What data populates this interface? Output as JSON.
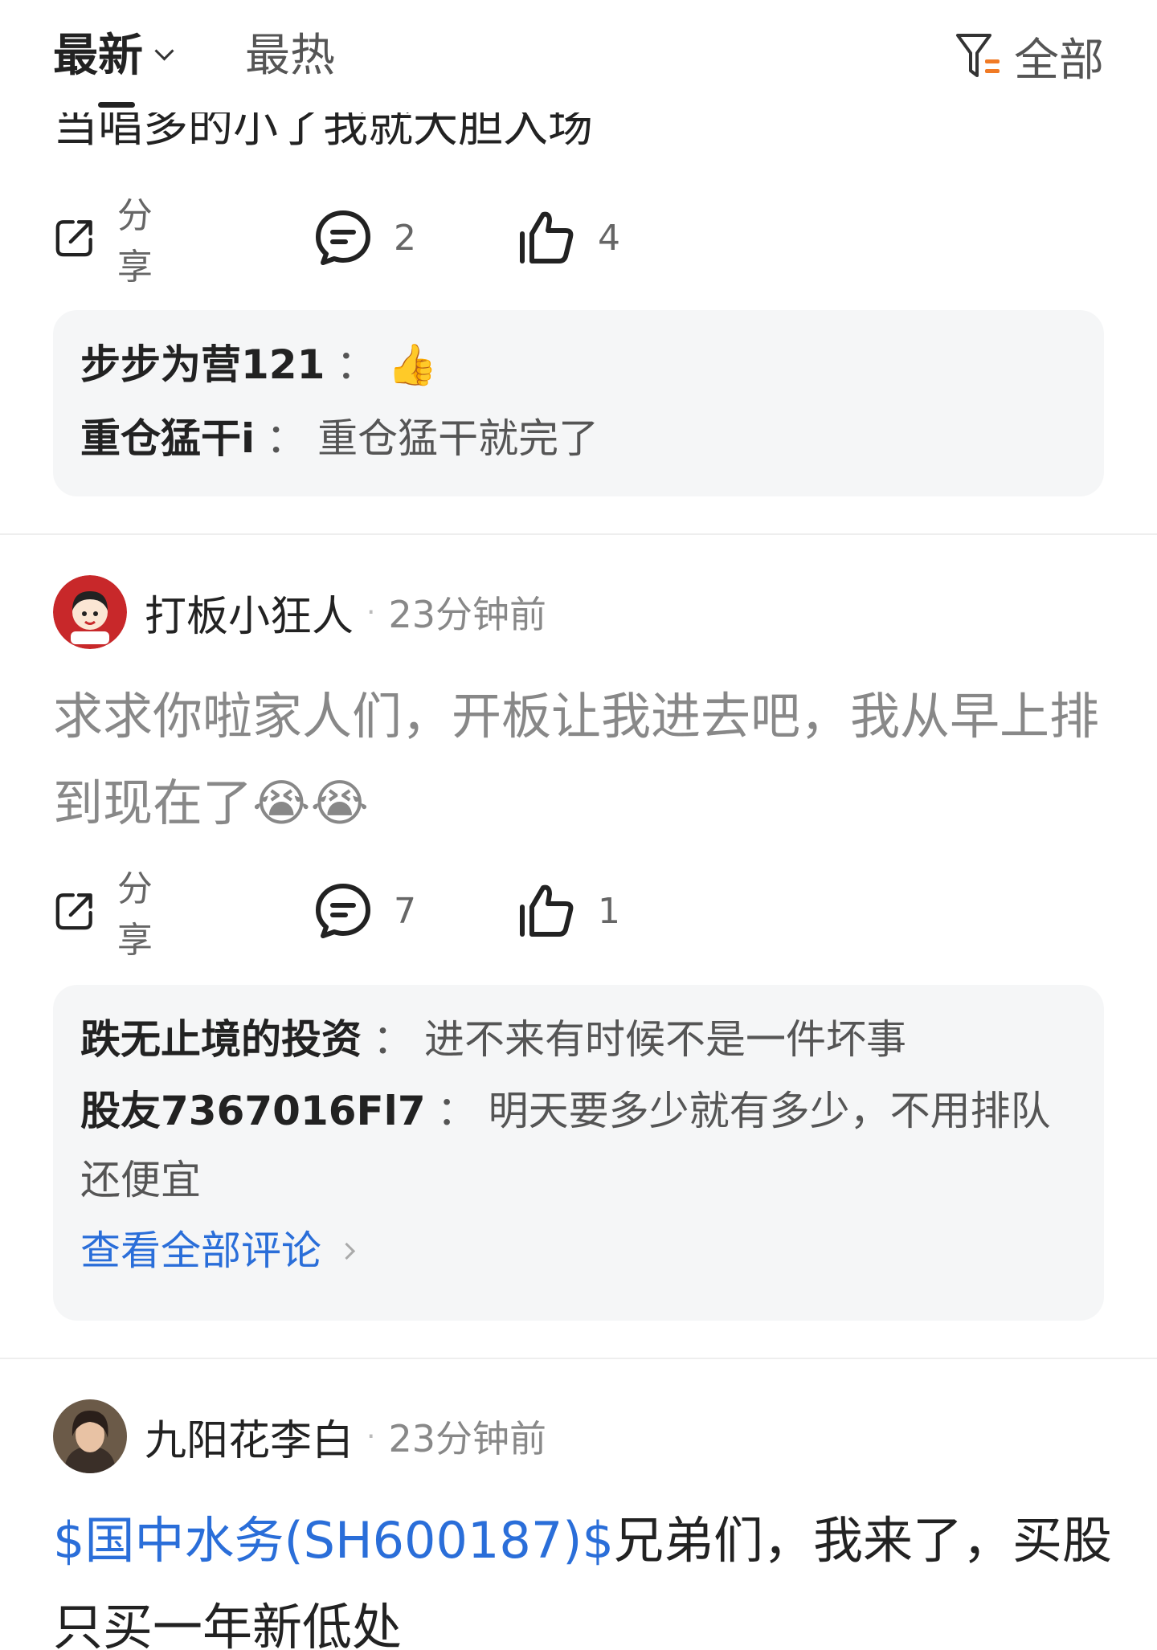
{
  "tabs": {
    "latest": "最新",
    "hot": "最热",
    "filter": "全部"
  },
  "post1": {
    "text_partial": "当唱多的小了我就大胆入场",
    "share_label": "分享",
    "comments": "2",
    "likes": "4",
    "replies": [
      {
        "name": "步步为营121",
        "sep": "：",
        "text": "👍"
      },
      {
        "name": "重仓猛干i",
        "sep": "：",
        "text": "重仓猛干就完了"
      }
    ]
  },
  "post2": {
    "author": "打板小狂人",
    "time": "23分钟前",
    "text": "求求你啦家人们，开板让我进去吧，我从早上排到现在了😭😭",
    "share_label": "分享",
    "comments": "7",
    "likes": "1",
    "replies": [
      {
        "name": "跌无止境的投资",
        "sep": "：",
        "text": "进不来有时候不是一件坏事"
      },
      {
        "name": "股友7367016Fl7",
        "sep": "：",
        "text": "明天要多少就有多少，不用排队还便宜"
      }
    ],
    "view_all": "查看全部评论"
  },
  "post3": {
    "author": "九阳花李白",
    "time": "23分钟前",
    "stock": "$国中水务(SH600187)$",
    "text": "兄弟们，我来了，买股只买一年新低处"
  },
  "colors": {
    "link": "#2a6ed9",
    "reply_bg": "#f5f6f7",
    "filter_accent": "#f07a25"
  },
  "icons": [
    "filter-icon",
    "share-icon",
    "comment-icon",
    "thumbs-up-icon",
    "chevron-down-icon",
    "chevron-right-icon"
  ]
}
